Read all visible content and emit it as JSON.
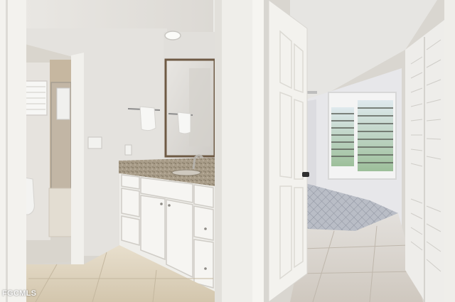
{
  "watermark": {
    "text": "FGCMLS"
  },
  "colors": {
    "wall": "#e6e4e0",
    "tile": "#ddd2bd",
    "granite": "#a69a86",
    "mirror_frame": "#6e5a44",
    "door": "#f1f0ec",
    "window_light": "#c9dcd2"
  }
}
